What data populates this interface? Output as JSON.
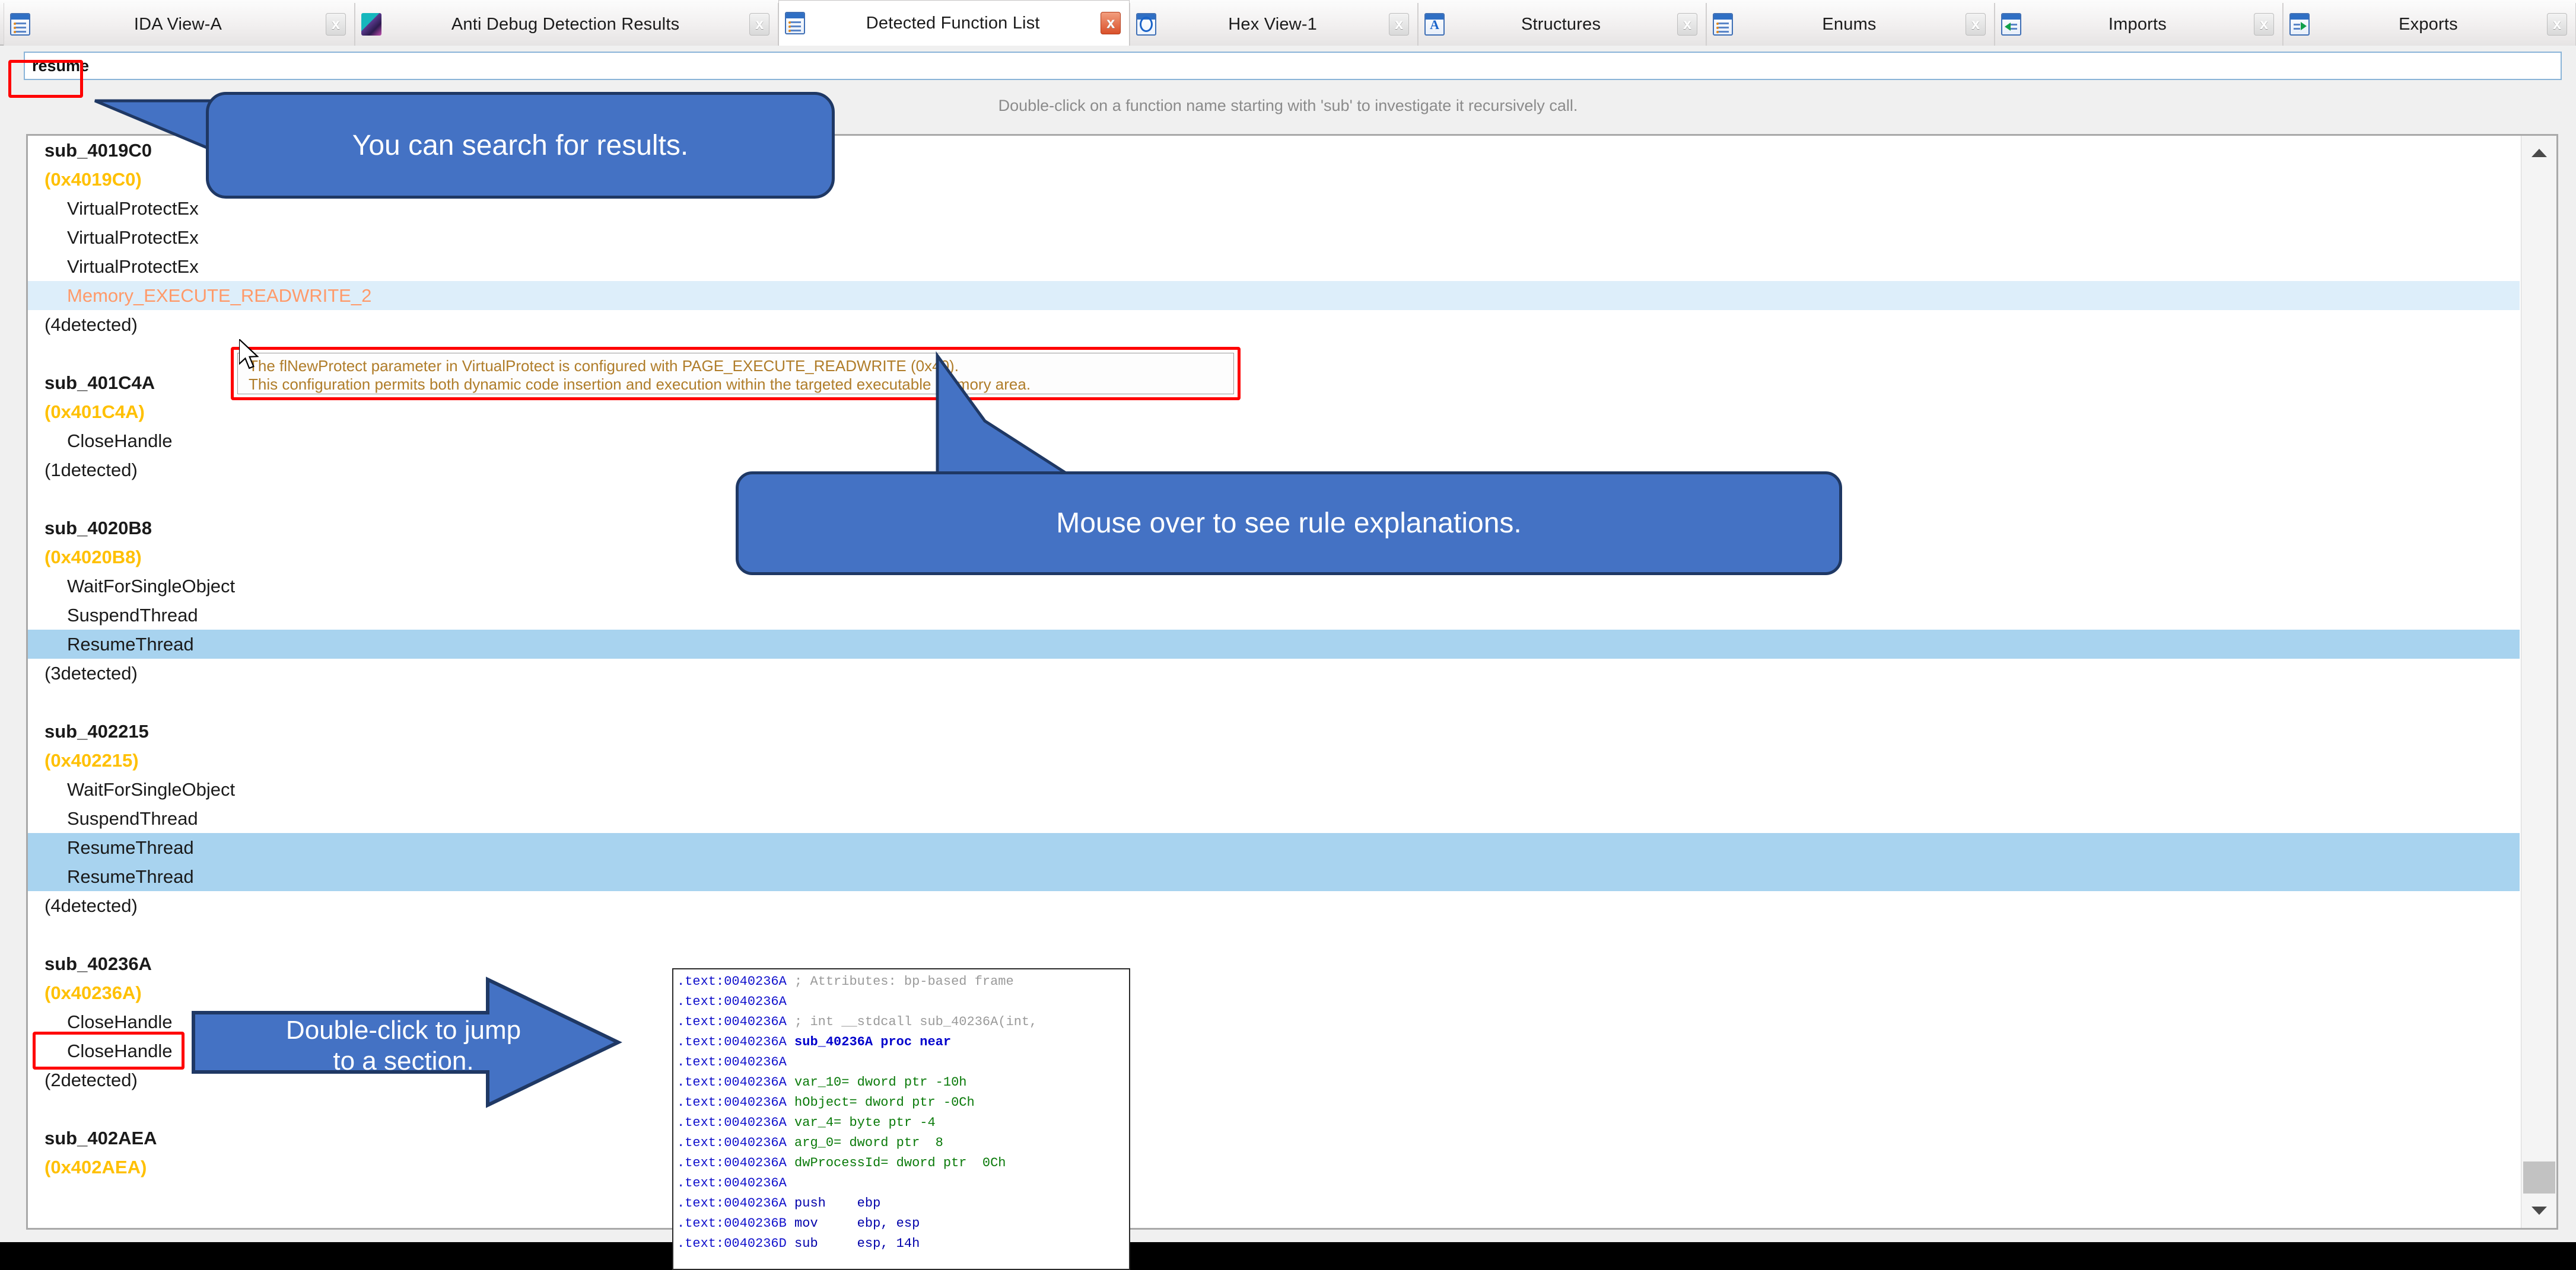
{
  "window": {
    "tabs": [
      {
        "label": "IDA View-A",
        "icon": "ida-view-icon",
        "active": false,
        "close_label": "x",
        "close_red": false
      },
      {
        "label": "Anti Debug Detection Results",
        "icon": "photo-icon",
        "active": false,
        "close_label": "x",
        "close_red": false
      },
      {
        "label": "Detected Function List",
        "icon": "ida-view-icon",
        "active": true,
        "close_label": "x",
        "close_red": true
      },
      {
        "label": "Hex View-1",
        "icon": "hex-view-icon",
        "active": false,
        "close_label": "x",
        "close_red": false
      },
      {
        "label": "Structures",
        "icon": "structures-icon",
        "active": false,
        "close_label": "x",
        "close_red": false
      },
      {
        "label": "Enums",
        "icon": "enums-icon",
        "active": false,
        "close_label": "x",
        "close_red": false
      },
      {
        "label": "Imports",
        "icon": "imports-icon",
        "active": false,
        "close_label": "x",
        "close_red": false
      },
      {
        "label": "Exports",
        "icon": "exports-icon",
        "active": false,
        "close_label": "x",
        "close_red": false
      }
    ]
  },
  "search": {
    "value": "resume",
    "placeholder": ""
  },
  "hint": {
    "text": "Double-click on a function name starting with 'sub' to investigate it recursively call."
  },
  "list": [
    {
      "type": "function",
      "text": "sub_4019C0"
    },
    {
      "type": "address",
      "text": "(0x4019C0)"
    },
    {
      "type": "api",
      "text": "VirtualProtectEx"
    },
    {
      "type": "api",
      "text": "VirtualProtectEx"
    },
    {
      "type": "api",
      "text": "VirtualProtectEx"
    },
    {
      "type": "rule",
      "text": "Memory_EXECUTE_READWRITE_2",
      "highlight": "light"
    },
    {
      "type": "count",
      "text": "(4detected)"
    },
    {
      "type": "blank",
      "text": ""
    },
    {
      "type": "function",
      "text": "sub_401C4A"
    },
    {
      "type": "address",
      "text": "(0x401C4A)"
    },
    {
      "type": "api",
      "text": "CloseHandle"
    },
    {
      "type": "count",
      "text": "(1detected)"
    },
    {
      "type": "blank",
      "text": ""
    },
    {
      "type": "function",
      "text": "sub_4020B8"
    },
    {
      "type": "address",
      "text": "(0x4020B8)"
    },
    {
      "type": "api",
      "text": "WaitForSingleObject"
    },
    {
      "type": "api",
      "text": "SuspendThread"
    },
    {
      "type": "api",
      "text": "ResumeThread",
      "highlight": "strong"
    },
    {
      "type": "count",
      "text": "(3detected)"
    },
    {
      "type": "blank",
      "text": ""
    },
    {
      "type": "function",
      "text": "sub_402215"
    },
    {
      "type": "address",
      "text": "(0x402215)"
    },
    {
      "type": "api",
      "text": "WaitForSingleObject"
    },
    {
      "type": "api",
      "text": "SuspendThread"
    },
    {
      "type": "api",
      "text": "ResumeThread",
      "highlight": "strong"
    },
    {
      "type": "api",
      "text": "ResumeThread",
      "highlight": "strong"
    },
    {
      "type": "count",
      "text": "(4detected)"
    },
    {
      "type": "blank",
      "text": ""
    },
    {
      "type": "function",
      "text": "sub_40236A"
    },
    {
      "type": "address",
      "text": "(0x40236A)"
    },
    {
      "type": "api",
      "text": "CloseHandle"
    },
    {
      "type": "api",
      "text": "CloseHandle"
    },
    {
      "type": "count",
      "text": "(2detected)"
    },
    {
      "type": "blank",
      "text": ""
    },
    {
      "type": "function",
      "text": "sub_402AEA"
    },
    {
      "type": "address",
      "text": "(0x402AEA)"
    }
  ],
  "tooltip": {
    "line1": "The flNewProtect parameter in VirtualProtect is configured with PAGE_EXECUTE_READWRITE (0x40).",
    "line2": "This configuration permits both dynamic code insertion and execution within the targeted executable memory area."
  },
  "callouts": {
    "search": "You can search for results.",
    "mouseover": "Mouse over to see rule explanations.",
    "doubleclick_line1": "Double-click to jump",
    "doubleclick_line2": "to a section."
  },
  "disassembly": {
    "lines": [
      {
        "addr": ".text:0040236A",
        "body": "; Attributes: bp-based frame",
        "cls": "dcomment"
      },
      {
        "addr": ".text:0040236A",
        "body": "",
        "cls": ""
      },
      {
        "addr": ".text:0040236A",
        "body": "; int __stdcall sub_40236A(int,",
        "cls": "dcomment"
      },
      {
        "addr": ".text:0040236A",
        "body": "sub_40236A proc near",
        "cls": "dproc"
      },
      {
        "addr": ".text:0040236A",
        "body": "",
        "cls": ""
      },
      {
        "addr": ".text:0040236A",
        "body": "var_10= dword ptr -10h",
        "cls": "dvar"
      },
      {
        "addr": ".text:0040236A",
        "body": "hObject= dword ptr -0Ch",
        "cls": "dvar"
      },
      {
        "addr": ".text:0040236A",
        "body": "var_4= byte ptr -4",
        "cls": "dvar"
      },
      {
        "addr": ".text:0040236A",
        "body": "arg_0= dword ptr  8",
        "cls": "dvar"
      },
      {
        "addr": ".text:0040236A",
        "body": "dwProcessId= dword ptr  0Ch",
        "cls": "dvar"
      },
      {
        "addr": ".text:0040236A",
        "body": "",
        "cls": ""
      },
      {
        "addr": ".text:0040236A",
        "body": "push    ebp",
        "cls": "dreg"
      },
      {
        "addr": ".text:0040236B",
        "body": "mov     ebp, esp",
        "cls": "dreg"
      },
      {
        "addr": ".text:0040236D",
        "body": "sub     esp, 14h",
        "cls": "dreg"
      }
    ]
  },
  "scrollbar": {
    "up_icon": "chevron-up-icon",
    "down_icon": "chevron-down-icon"
  }
}
